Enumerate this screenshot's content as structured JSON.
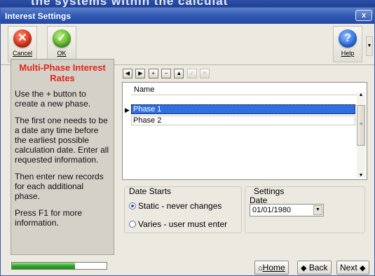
{
  "background_text": "the systems within the calculat",
  "window": {
    "title": "Interest Settings",
    "close_label": "x"
  },
  "toolbar": {
    "cancel": {
      "glyph": "✕",
      "label": "Cancel"
    },
    "ok": {
      "glyph": "✓",
      "label": "OK"
    },
    "help": {
      "glyph": "?",
      "label": "Help"
    }
  },
  "sidebar": {
    "heading": "Multi-Phase Interest Rates",
    "paragraphs": [
      "Use the + button to create a new phase.",
      "The first one needs to be a date any time before the earliest possible calculation date. Enter all requested information.",
      "Then enter new records for each additional phase.",
      "Press F1 for more information."
    ]
  },
  "nav_buttons": [
    {
      "glyph": "◀",
      "name": "prev-record-button",
      "enabled": true
    },
    {
      "glyph": "▶",
      "name": "next-record-button",
      "enabled": true
    },
    {
      "glyph": "+",
      "name": "add-record-button",
      "enabled": true
    },
    {
      "glyph": "−",
      "name": "delete-record-button",
      "enabled": true
    },
    {
      "glyph": "▲",
      "name": "edit-record-button",
      "enabled": true
    },
    {
      "glyph": "✓",
      "name": "post-record-button",
      "enabled": false
    },
    {
      "glyph": "✕",
      "name": "cancel-record-button",
      "enabled": false
    }
  ],
  "grid": {
    "column": "Name",
    "rows": [
      "Phase 1",
      "Phase 2"
    ],
    "selected_index": 0
  },
  "date_starts": {
    "legend": "Date Starts",
    "options": [
      "Static - never changes",
      "Varies - user must enter"
    ],
    "selected_index": 0
  },
  "settings": {
    "legend": "Settings",
    "date_label": "Date",
    "date_value": "01/01/1980"
  },
  "progress": {
    "value": 0.67
  },
  "footer": {
    "home": "Home",
    "back": "Back",
    "next": "Next"
  },
  "colors": {
    "title_bar": "#2d56b2",
    "heading_red": "#e2261b",
    "selection_blue": "#2f6fe0",
    "progress_green": "#2ea62a"
  }
}
